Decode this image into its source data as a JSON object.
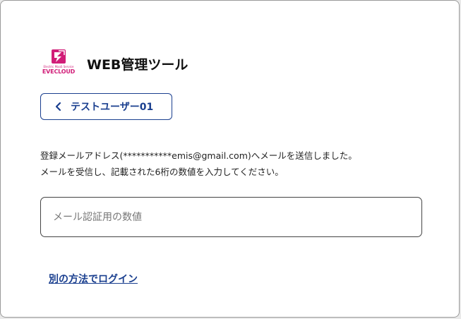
{
  "brand": {
    "logo_sub": "Electric MaaS Service",
    "logo_name": "EVECLOUD",
    "accent_color": "#d11d78"
  },
  "header": {
    "title": "WEB管理ツール"
  },
  "back_button": {
    "label": "テストユーザー01",
    "icon": "chevron-left-icon",
    "color": "#1a3f8f"
  },
  "message": {
    "line1": "登録メールアドレス(***********emis@gmail.com)へメールを送信しました。",
    "line2": "メールを受信し、記載された6桁の数値を入力してください。"
  },
  "code_input": {
    "placeholder": "メール認証用の数値",
    "value": ""
  },
  "alt_login": {
    "label": "別の方法でログイン"
  }
}
